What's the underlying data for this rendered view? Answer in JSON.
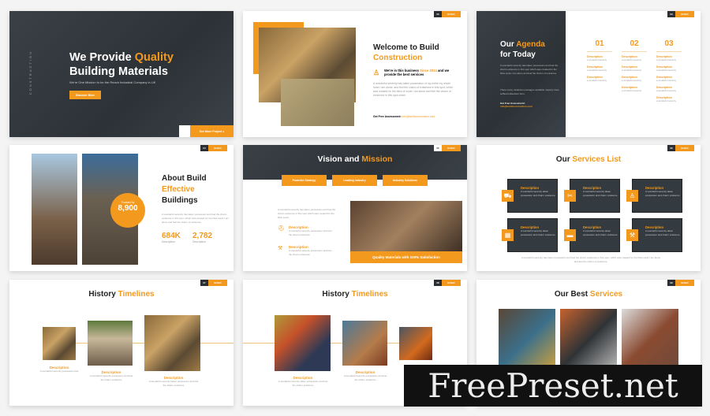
{
  "brand_color": "#f39a1e",
  "tag_label": "BUILD",
  "s1": {
    "vertical": "CONSTRUCTION",
    "title_a": "We Provide ",
    "title_b": "Quality",
    "title_c": "Building Materials",
    "subtitle": "We're One Mission to be the Reach Industrial Company in UK",
    "button": "Discover More",
    "see_more": "See More Project"
  },
  "s2": {
    "page": "02",
    "title_a": "Welcome to Build",
    "title_b": "Construction",
    "lead_a": "We're in this business ",
    "lead_b": "Since 2014",
    "lead_c": " and we provide the best services",
    "body": "A wonderful serenity has taken possession of my entire my whole heart I am alone, and feel the charm of existence in this spot, which was created for the bliss of souls I am alone and feel the charm of existence in this spot which.",
    "contact_label": "Get Free Assessment:",
    "contact_value": "info@buildconstruction.com"
  },
  "s3": {
    "page": "03",
    "title_a": "Our ",
    "title_b": "Agenda",
    "title_c": "for Today",
    "body": "A wonderful serenity has taken possession and feel the charm existence in this spot which was created for the bliss souls I am alone and feel the charm of existence.",
    "body2": "There many variations passages available majority have suffered alteration form.",
    "contact_label": "Get Free Assessment:",
    "contact_value": "info@buildconstruction.com",
    "columns": [
      {
        "num": "01",
        "items": 3
      },
      {
        "num": "02",
        "items": 4
      },
      {
        "num": "03",
        "items": 5
      }
    ],
    "item_title": "Description",
    "item_text": "a wonderful serenity"
  },
  "s4": {
    "page": "04",
    "title_a": "About Build",
    "title_b": "Effective",
    "title_c": "Buildings",
    "badge_label": "Trusted by",
    "badge_value": "8,900",
    "body": "A wonderful serenity has taken possession and feel the charm existence in this spot, which was created for the bliss souls I am alone and feel the charm of existence.",
    "stats": [
      {
        "value": "684K",
        "label": "Description"
      },
      {
        "value": "2,782",
        "label": "Description"
      }
    ]
  },
  "s5": {
    "page": "05",
    "title_a": "Vision and ",
    "title_b": "Mission",
    "tabs": [
      "Powerful Strategy",
      "Leading Industry",
      "Industry Solutions"
    ],
    "body": "A wonderful serenity has taken possession and feel the charm existence in this spot which was created for the bliss souls.",
    "items": [
      {
        "title": "Description",
        "text": "A wonderful serenity possession and feel the charm existence"
      },
      {
        "title": "Description",
        "text": "A wonderful serenity possession and feel the charm existence"
      }
    ],
    "banner": "Quality Materials with 100% Satisfaction"
  },
  "s6": {
    "page": "06",
    "title_a": "Our ",
    "title_b": "Services List",
    "cards": [
      {
        "icon": "truck-icon",
        "title": "Description",
        "text": "A wonderful serenity taken possession and charm existence"
      },
      {
        "icon": "tools-icon",
        "title": "Description",
        "text": "A wonderful serenity taken possession and charm existence"
      },
      {
        "icon": "worker-icon",
        "title": "Description",
        "text": "A wonderful serenity taken possession and charm existence"
      },
      {
        "icon": "barrier-icon",
        "title": "Description",
        "text": "A wonderful serenity taken possession and charm existence"
      },
      {
        "icon": "toolbox-icon",
        "title": "Description",
        "text": "A wonderful serenity taken possession and charm existence"
      },
      {
        "icon": "crane-icon",
        "title": "Description",
        "text": "A wonderful serenity taken possession and charm existence"
      }
    ],
    "footer": "A wonderful serenity has taken possession and feel the charm existence in this spot, which was created for the bliss souls I am alone and feel the charm of existence."
  },
  "s7": {
    "page": "07",
    "title_a": "History ",
    "title_b": "Timelines",
    "items": [
      {
        "title": "Description",
        "text": "A wonderful serenity possession feel"
      },
      {
        "title": "Description",
        "text": "A wonderful serenity possession and feel the charm existence"
      },
      {
        "title": "Description",
        "text": "A wonderful serenity taken possession and feel the charm existence"
      }
    ]
  },
  "s8": {
    "page": "08",
    "title_a": "History ",
    "title_b": "Timelines",
    "items": [
      {
        "title": "Description",
        "text": "A wonderful serenity taken possession and feel the charm existence"
      },
      {
        "title": "Description",
        "text": "A wonderful serenity possession and feel the charm existence"
      }
    ]
  },
  "s9": {
    "page": "09",
    "title_a": "Our Best ",
    "title_b": "Services"
  },
  "watermark": "FreePreset.net"
}
